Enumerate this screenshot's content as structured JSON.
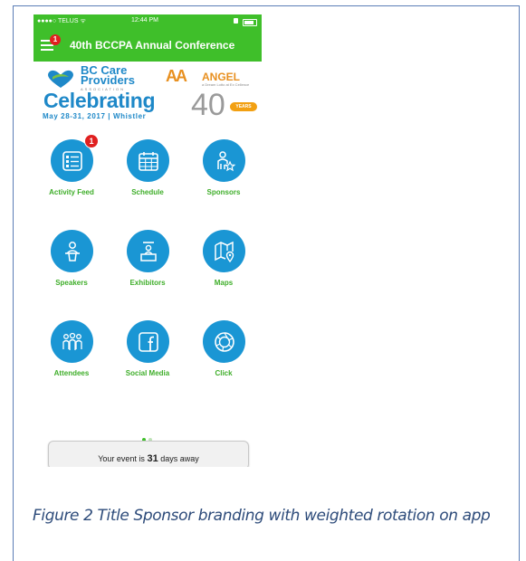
{
  "status_bar": {
    "carrier": "●●●●○ TELUS ᯤ",
    "time": "12:44 PM"
  },
  "header": {
    "title": "40th BCCPA Annual Conference",
    "menu_badge": "1"
  },
  "banner": {
    "org_name_line1": "BC Care",
    "org_name_line2": "Providers",
    "org_sub": "ASSOCIATION",
    "sponsor_mark": "AA",
    "sponsor_name": "ANGEL",
    "sponsor_sub": "a Dream Lotto at Ex Cellence",
    "celebrating": "Celebrating",
    "forty": "40",
    "years": "YEARS",
    "dates": "May 28-31, 2017 | Whistler"
  },
  "tiles": [
    {
      "label": "Activity Feed",
      "icon": "activity-feed-icon",
      "badge": "1"
    },
    {
      "label": "Schedule",
      "icon": "calendar-icon",
      "badge": ""
    },
    {
      "label": "Sponsors",
      "icon": "sponsor-star-icon",
      "badge": ""
    },
    {
      "label": "Speakers",
      "icon": "speaker-podium-icon",
      "badge": ""
    },
    {
      "label": "Exhibitors",
      "icon": "exhibitor-booth-icon",
      "badge": ""
    },
    {
      "label": "Maps",
      "icon": "map-pin-icon",
      "badge": ""
    },
    {
      "label": "Attendees",
      "icon": "attendees-icon",
      "badge": ""
    },
    {
      "label": "Social Media",
      "icon": "facebook-icon",
      "badge": ""
    },
    {
      "label": "Click",
      "icon": "camera-shutter-icon",
      "badge": ""
    }
  ],
  "pager": {
    "active_color": "#3fbf2a",
    "inactive_color": "#bfe3b8"
  },
  "countdown": {
    "prefix": "Your event is",
    "days": "31",
    "suffix": "days away"
  },
  "caption": "Figure 2 Title Sponsor branding with weighted rotation on app",
  "colors": {
    "header_green": "#3fbf2a",
    "icon_blue": "#1a96d4",
    "label_green": "#3fae2a",
    "badge_red": "#e02020"
  }
}
